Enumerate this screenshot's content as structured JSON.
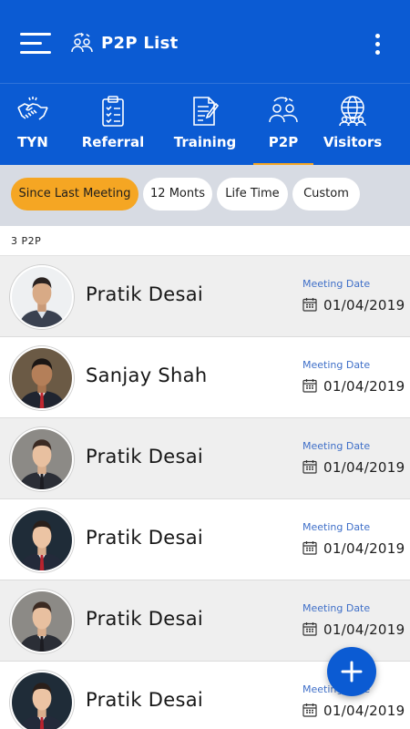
{
  "appbar": {
    "title": "P2P List",
    "menu_icon": "hamburger-menu-icon",
    "title_icon": "people-exchange-icon",
    "overflow_icon": "more-vertical-icon"
  },
  "tabs": [
    {
      "label": "TYN",
      "icon": "handshake-icon"
    },
    {
      "label": "Referral",
      "icon": "clipboard-checklist-icon"
    },
    {
      "label": "Training",
      "icon": "document-edit-icon"
    },
    {
      "label": "P2P",
      "icon": "people-exchange-icon",
      "active": true
    },
    {
      "label": "Visitors",
      "icon": "globe-people-icon"
    }
  ],
  "filters": [
    {
      "label": "Since Last Meeting",
      "active": true
    },
    {
      "label": "12 Monts"
    },
    {
      "label": "Life Time"
    },
    {
      "label": "Custom"
    }
  ],
  "list_count": "3 P2P",
  "rows": [
    {
      "name": "Pratik Desai",
      "meeting_label": "Meeting Date",
      "date": "01/04/2019"
    },
    {
      "name": "Sanjay Shah",
      "meeting_label": "Meeting Date",
      "date": "01/04/2019"
    },
    {
      "name": "Pratik Desai",
      "meeting_label": "Meeting Date",
      "date": "01/04/2019"
    },
    {
      "name": "Pratik Desai",
      "meeting_label": "Meeting Date",
      "date": "01/04/2019"
    },
    {
      "name": "Pratik Desai",
      "meeting_label": "Meeting Date",
      "date": "01/04/2019"
    },
    {
      "name": "Pratik Desai",
      "meeting_label": "Meeting Date",
      "date": "01/04/2019"
    }
  ],
  "fab": {
    "icon": "plus-icon"
  },
  "colors": {
    "primary": "#0b5bd3",
    "accent": "#f5a623",
    "filter_bg": "#d7dbe3",
    "meeting_label": "#3f6fc8"
  }
}
